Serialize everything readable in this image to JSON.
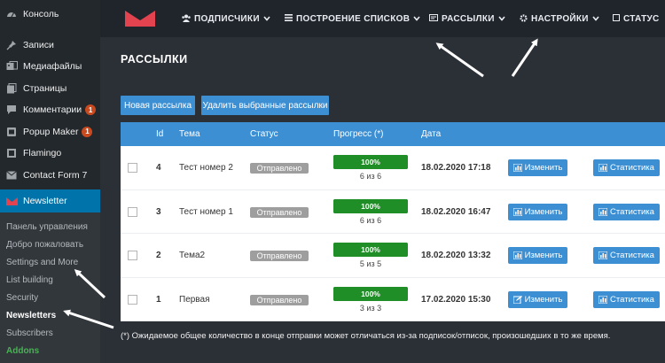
{
  "sidebar": {
    "items": [
      {
        "label": "Консоль",
        "icon": "dashboard-icon",
        "badge": null
      },
      {
        "label": "Записи",
        "icon": "pin-icon",
        "badge": null
      },
      {
        "label": "Медиафайлы",
        "icon": "media-icon",
        "badge": null
      },
      {
        "label": "Страницы",
        "icon": "pages-icon",
        "badge": null
      },
      {
        "label": "Комментарии",
        "icon": "comments-icon",
        "badge": "1"
      },
      {
        "label": "Popup Maker",
        "icon": "popup-icon",
        "badge": "1"
      },
      {
        "label": "Flamingo",
        "icon": "flamingo-icon",
        "badge": null
      },
      {
        "label": "Contact Form 7",
        "icon": "mail-icon",
        "badge": null
      }
    ],
    "active": {
      "label": "Newsletter",
      "icon": "newsletter-icon"
    },
    "submenu": [
      "Панель управления",
      "Добро пожаловать",
      "Settings and More",
      "List building",
      "Security",
      "Newsletters",
      "Subscribers",
      "Addons"
    ]
  },
  "topnav": {
    "items": [
      {
        "label": "ПОДПИСЧИКИ",
        "icon": "users-icon",
        "chevron": true
      },
      {
        "label": "ПОСТРОЕНИЕ СПИСКОВ",
        "icon": "list-icon",
        "chevron": true
      },
      {
        "label": "РАССЫЛКИ",
        "icon": "envelope-icon",
        "chevron": true
      },
      {
        "label": "НАСТРОЙКИ",
        "icon": "gear-icon",
        "chevron": true
      },
      {
        "label": "СТАТУС",
        "icon": "square-icon",
        "chevron": false
      }
    ]
  },
  "page": {
    "title": "РАССЫЛКИ",
    "new_button": "Новая рассылка",
    "delete_button": "Удалить выбранные рассылки"
  },
  "table": {
    "headers": {
      "id": "Id",
      "subject": "Тема",
      "status": "Статус",
      "progress": "Прогресс (*)",
      "date": "Дата"
    },
    "rows": [
      {
        "id": "4",
        "subject": "Тест номер 2",
        "status": "Отправлено",
        "progress": 100,
        "progress_label": "100%",
        "progress_text": "6 из 6",
        "date": "18.02.2020 17:18",
        "edit": "Изменить",
        "edit_icon": "chart-bar-icon",
        "stats": "Статистика"
      },
      {
        "id": "3",
        "subject": "Тест номер 1",
        "status": "Отправлено",
        "progress": 100,
        "progress_label": "100%",
        "progress_text": "6 из 6",
        "date": "18.02.2020 16:47",
        "edit": "Изменить",
        "edit_icon": "chart-bar-icon",
        "stats": "Статистика"
      },
      {
        "id": "2",
        "subject": "Тема2",
        "status": "Отправлено",
        "progress": 100,
        "progress_label": "100%",
        "progress_text": "5 из 5",
        "date": "18.02.2020 13:32",
        "edit": "Изменить",
        "edit_icon": "chart-bar-icon",
        "stats": "Статистика"
      },
      {
        "id": "1",
        "subject": "Первая",
        "status": "Отправлено",
        "progress": 100,
        "progress_label": "100%",
        "progress_text": "3 из 3",
        "date": "17.02.2020 15:30",
        "edit": "Изменить",
        "edit_icon": "edit-icon",
        "stats": "Статистика"
      }
    ]
  },
  "footnote": "(*) Ожидаемое общее количество в конце отправки может отличаться из-за подписок/отписок, произошедших в то же время.",
  "colors": {
    "accent": "#3d8fd3",
    "sidebar": "#23282d",
    "active": "#0073aa",
    "success": "#1f8e26",
    "badge": "#ca4a1f",
    "logo": "#e2434f"
  }
}
